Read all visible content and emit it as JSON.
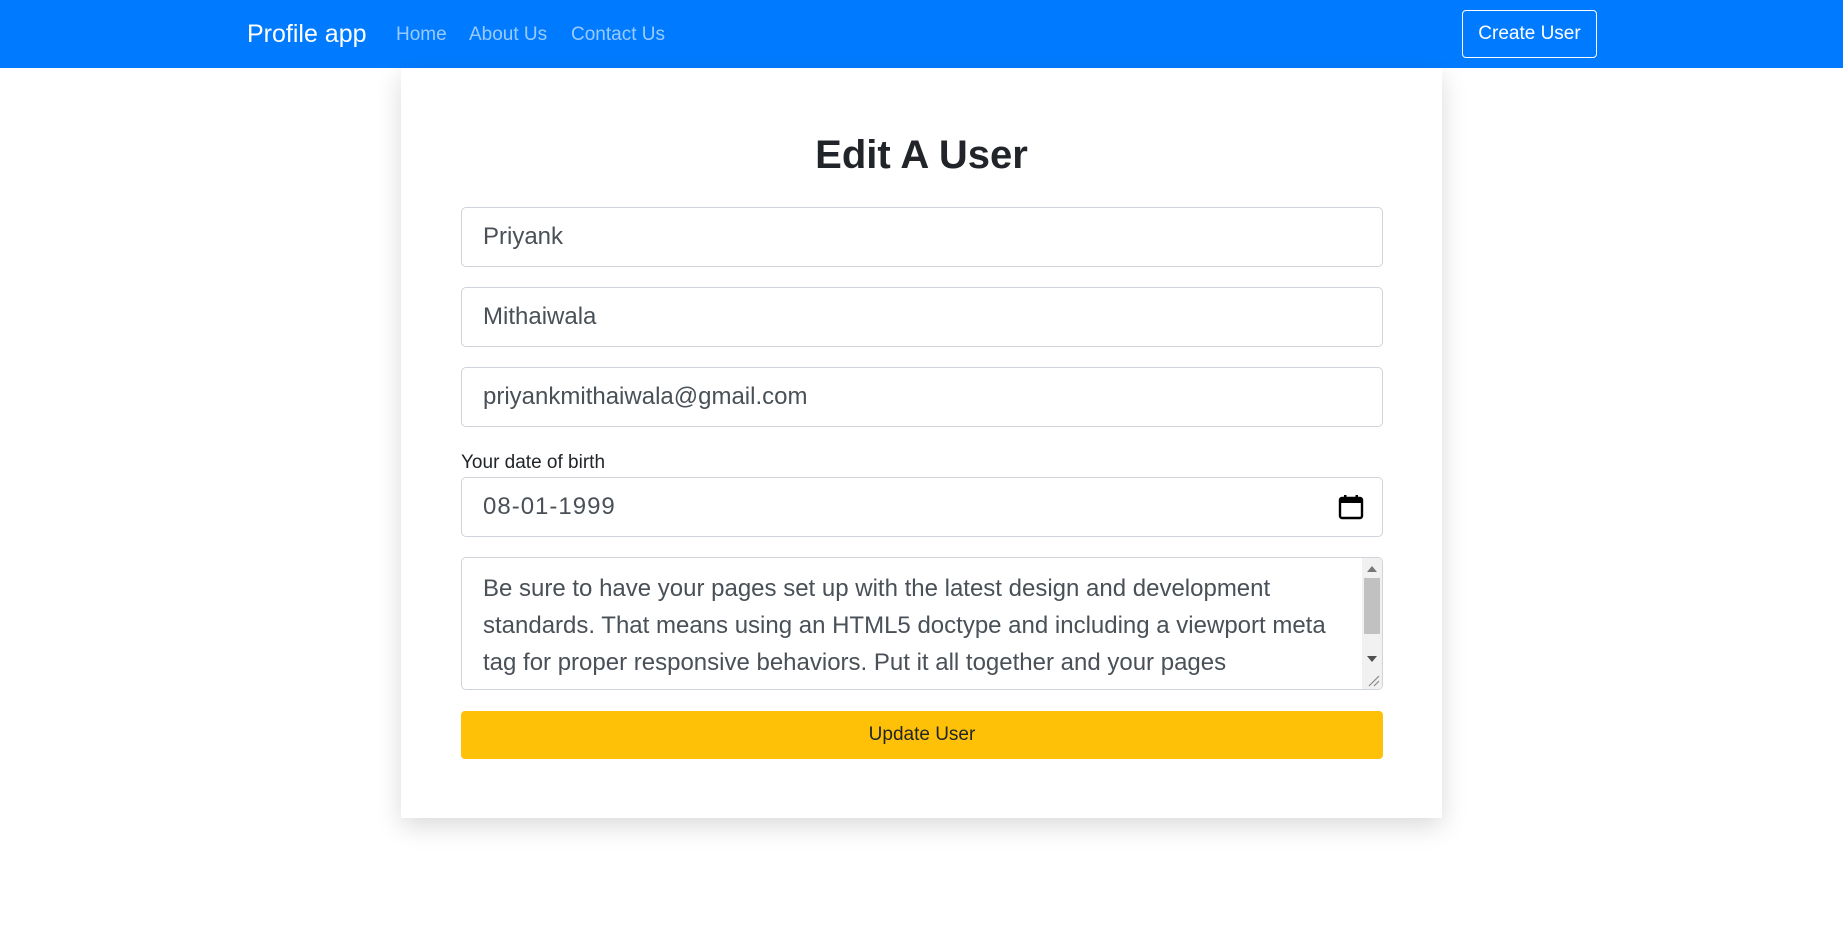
{
  "navbar": {
    "brand": "Profile app",
    "links": [
      "Home",
      "About Us",
      "Contact Us"
    ],
    "create_button": "Create User",
    "background_color": "#007bff"
  },
  "form": {
    "title": "Edit A User",
    "first_name": "Priyank",
    "last_name": "Mithaiwala",
    "email": "priyankmithaiwala@gmail.com",
    "dob_label": "Your date of birth",
    "dob_value": "08-01-1999",
    "bio": "Be sure to have your pages set up with the latest design and development standards. That means using an HTML5 doctype and including a viewport meta tag for proper responsive behaviors. Put it all together and your pages",
    "submit_label": "Update User",
    "submit_color": "#ffc107"
  },
  "icons": {
    "date_picker": "calendar-icon"
  }
}
